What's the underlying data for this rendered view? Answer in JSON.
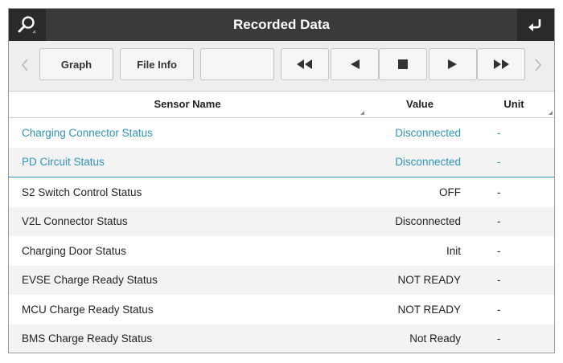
{
  "window": {
    "title": "Recorded Data"
  },
  "icons": {
    "search": "search-icon",
    "back": "return-icon"
  },
  "toolbar": {
    "graph_label": "Graph",
    "file_info_label": "File Info",
    "blank_label": ""
  },
  "table": {
    "headers": {
      "name": "Sensor Name",
      "value": "Value",
      "unit": "Unit"
    },
    "rows": [
      {
        "name": "Charging Connector Status",
        "value": "Disconnected",
        "unit": "-",
        "highlighted": true
      },
      {
        "name": "PD Circuit Status",
        "value": "Disconnected",
        "unit": "-",
        "highlighted": true
      },
      {
        "name": "S2 Switch Control Status",
        "value": "OFF",
        "unit": "-",
        "highlighted": false
      },
      {
        "name": "V2L Connector Status",
        "value": "Disconnected",
        "unit": "-",
        "highlighted": false
      },
      {
        "name": "Charging Door Status",
        "value": "Init",
        "unit": "-",
        "highlighted": false
      },
      {
        "name": "EVSE Charge Ready Status",
        "value": "NOT READY",
        "unit": "-",
        "highlighted": false
      },
      {
        "name": "MCU Charge Ready Status",
        "value": "NOT READY",
        "unit": "-",
        "highlighted": false
      },
      {
        "name": "BMS Charge Ready Status",
        "value": "Not Ready",
        "unit": "-",
        "highlighted": false
      }
    ]
  },
  "colors": {
    "title_bar": "#3a3a3a",
    "highlight_text": "#2e93b8"
  }
}
